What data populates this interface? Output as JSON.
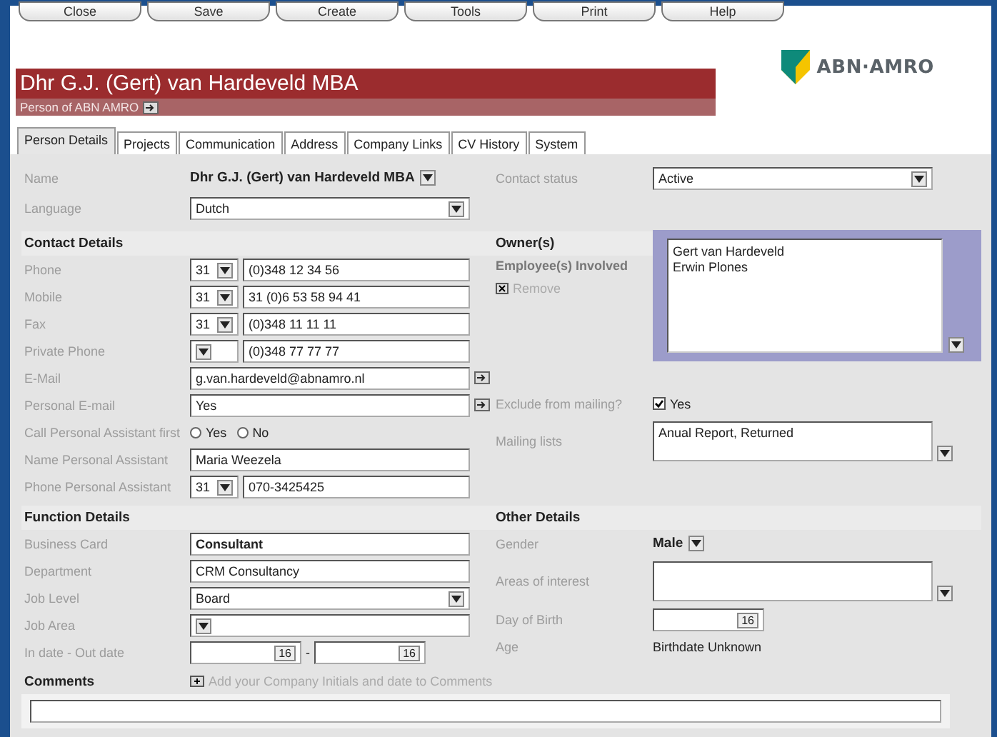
{
  "toolbar": [
    "Close",
    "Save",
    "Create",
    "Tools",
    "Print",
    "Help"
  ],
  "header": {
    "title": "Dhr G.J. (Gert) van Hardeveld MBA",
    "subtitle": "Person of ABN AMRO",
    "logo": "ABN·AMRO"
  },
  "tabs": [
    {
      "label": "Person Details",
      "selected": true
    },
    {
      "label": "Projects",
      "selected": false
    },
    {
      "label": "Communication",
      "selected": false
    },
    {
      "label": "Address",
      "selected": false
    },
    {
      "label": "Company Links",
      "selected": false
    },
    {
      "label": "CV History",
      "selected": false
    },
    {
      "label": "System",
      "selected": false
    }
  ],
  "person": [
    {
      "label": "Name",
      "kind": "static",
      "value": "Dhr G.J. (Gert) van Hardeveld MBA"
    },
    {
      "label": "Language",
      "kind": "select",
      "value": "Dutch"
    }
  ],
  "status": [
    {
      "label": "Contact status",
      "kind": "select",
      "value": "Active"
    }
  ],
  "contact_details": {
    "heading": "Contact Details",
    "fields": [
      {
        "label": "Phone",
        "kind": "phone",
        "code": "31",
        "value": "(0)348 12 34 56"
      },
      {
        "label": "Mobile",
        "kind": "phone",
        "code": "31",
        "value": "31 (0)6 53 58 94 41"
      },
      {
        "label": "Fax",
        "kind": "phone",
        "code": "31",
        "value": "(0)348 11 11 11"
      },
      {
        "label": "Private Phone",
        "kind": "phone",
        "value": "(0)348 77 77 77"
      },
      {
        "label": "E-Mail",
        "kind": "text_link",
        "value": "g.van.hardeveld@abnamro.nl"
      },
      {
        "label": "Personal E-mail",
        "kind": "text_link",
        "value": "Yes"
      },
      {
        "label": "Call Personal Assistant first",
        "kind": "radio",
        "options": [
          {
            "label": "Yes",
            "selected": false
          },
          {
            "label": "No",
            "selected": false
          }
        ]
      },
      {
        "label": "Name  Personal Assistant",
        "kind": "text",
        "value": "Maria Weezela"
      },
      {
        "label": "Phone  Personal Assistant",
        "kind": "phone",
        "code": "31",
        "value": "070-3425425"
      }
    ]
  },
  "owners": {
    "heading": "Owner(s)",
    "label": "Employee(s) Involved",
    "remove": "Remove",
    "employees": [
      "Gert van Hardeveld",
      "Erwin Plones"
    ]
  },
  "mailing": [
    {
      "label": "Exclude from mailing?",
      "kind": "check",
      "checked": true,
      "value": "Yes"
    },
    {
      "label": "Mailing lists",
      "kind": "list",
      "value": "Anual Report, Returned"
    }
  ],
  "function_details": {
    "heading": "Function Details",
    "fields": [
      {
        "label": "Business Card",
        "kind": "text",
        "bold": true,
        "value": "Consultant"
      },
      {
        "label": "Department",
        "kind": "text",
        "value": "CRM Consultancy"
      },
      {
        "label": "Job Level",
        "kind": "select",
        "value": "Board"
      },
      {
        "label": "Job Area",
        "kind": "select"
      },
      {
        "label": "In date - Out date",
        "kind": "dates",
        "buttons": [
          "16",
          "16"
        ],
        "separator": "-"
      }
    ]
  },
  "other_details": {
    "heading": "Other Details",
    "fields": [
      {
        "label": "Gender",
        "kind": "static",
        "value": "Male"
      },
      {
        "label": "Areas of interest",
        "kind": "list"
      },
      {
        "label": "Day of Birth",
        "kind": "date",
        "button": "16"
      },
      {
        "label": "Age",
        "kind": "plain",
        "value": "Birthdate Unknown"
      }
    ]
  },
  "comments": {
    "heading": "Comments",
    "hint": "Add your Company Initials and date to Comments"
  }
}
